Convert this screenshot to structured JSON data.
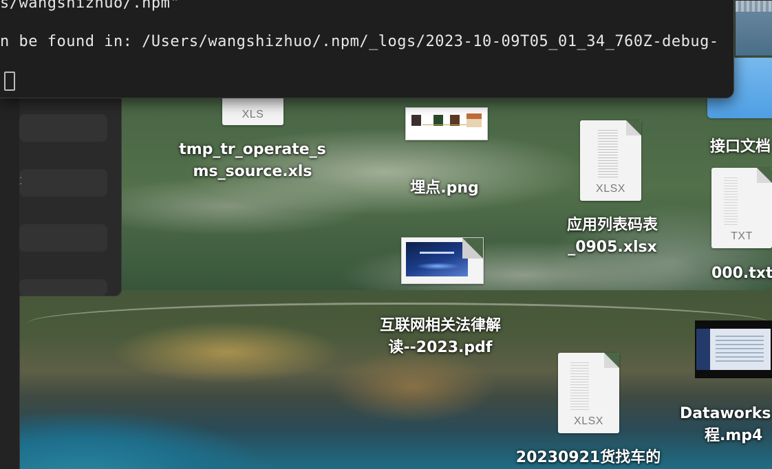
{
  "terminal": {
    "lines": [
      "s/wangshizhuo/.npm\"",
      "n be found in: /Users/wangshizhuo/.npm/_logs/2023-10-09T05_01_34_760Z-debug-"
    ]
  },
  "desktop": {
    "files": [
      {
        "name_line1": "tmp_tr_operate_s",
        "name_line2": "ms_source.xls",
        "ext": "XLS"
      },
      {
        "name_line1": "埋点.png",
        "name_line2": ""
      },
      {
        "name_line1": "应用列表码表",
        "name_line2": "_0905.xlsx",
        "ext": "XLSX"
      },
      {
        "name_line1": "接口文档",
        "name_line2": ""
      },
      {
        "name_line1": "000.txt",
        "name_line2": "",
        "ext": "TXT"
      },
      {
        "name_line1": "互联网相关法律解",
        "name_line2": "读--2023.pdf"
      },
      {
        "name_line1": "Dataworks",
        "name_line2": "程.mp4"
      },
      {
        "name_line1": "20230921货找车的",
        "name_line2": "",
        "ext": "XLSX"
      }
    ]
  }
}
